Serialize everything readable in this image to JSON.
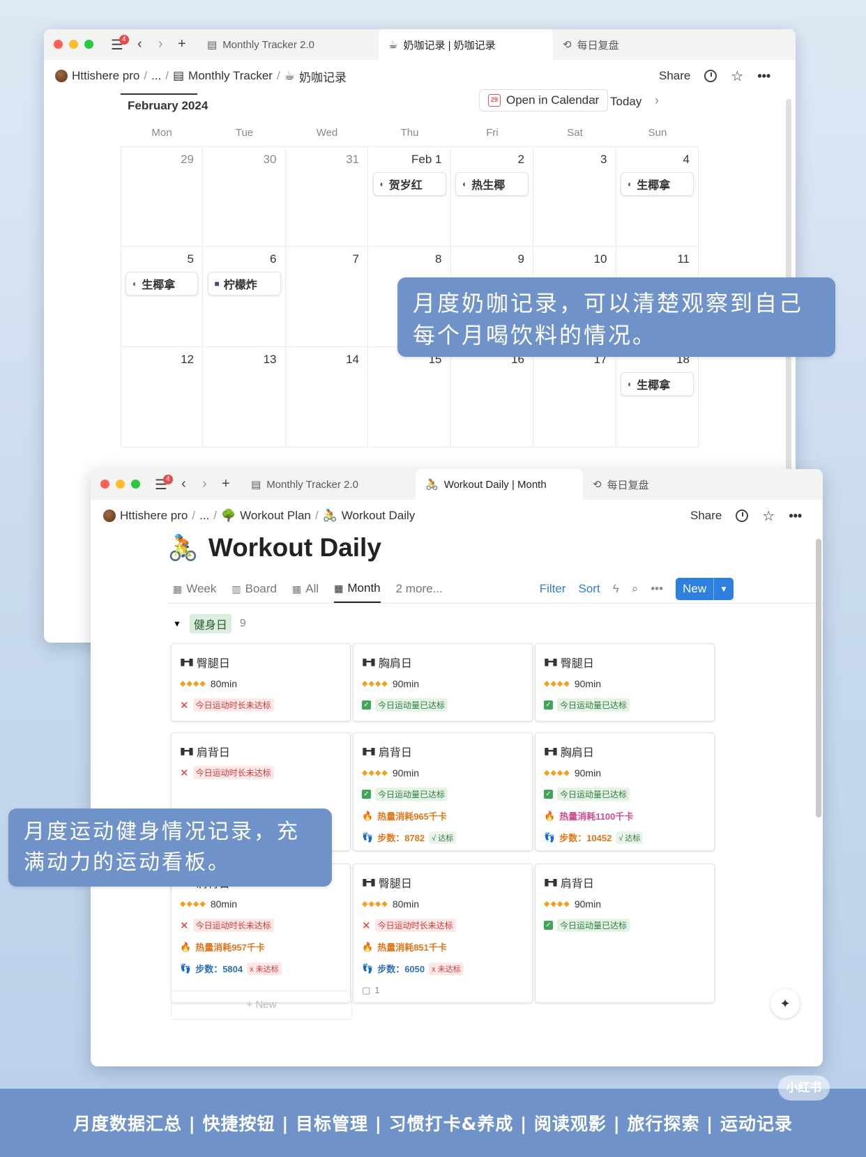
{
  "calendar_window": {
    "tab_count": "4",
    "tabs": [
      {
        "label": "Monthly Tracker 2.0",
        "icon": "calendar-icon"
      },
      {
        "label": "奶咖记录 | 奶咖记录",
        "icon": "coffee-icon"
      },
      {
        "label": "每日复盘",
        "icon": "history-icon"
      }
    ],
    "breadcrumb": [
      "Httishere pro",
      "...",
      "Monthly Tracker",
      "奶咖记录"
    ],
    "share": "Share",
    "month": "February 2024",
    "open_calendar": "Open in Calendar",
    "open_calendar_icon_num": "29",
    "today": "Today",
    "weekdays": [
      "Mon",
      "Tue",
      "Wed",
      "Thu",
      "Fri",
      "Sat",
      "Sun"
    ],
    "weeks": [
      [
        {
          "d": "29"
        },
        {
          "d": "30"
        },
        {
          "d": "31"
        },
        {
          "d": "Feb 1",
          "e": "贺岁红"
        },
        {
          "d": "2",
          "e": "热生椰"
        },
        {
          "d": "3"
        },
        {
          "d": "4",
          "e": "生椰拿"
        }
      ],
      [
        {
          "d": "5",
          "e": "生椰拿"
        },
        {
          "d": "6",
          "e": "柠檬炸"
        },
        {
          "d": "7"
        },
        {
          "d": "8"
        },
        {
          "d": "9"
        },
        {
          "d": "10"
        },
        {
          "d": "11"
        }
      ],
      [
        {
          "d": "12"
        },
        {
          "d": "13"
        },
        {
          "d": "14"
        },
        {
          "d": "15"
        },
        {
          "d": "16"
        },
        {
          "d": "17"
        },
        {
          "d": "18",
          "e": "生椰拿"
        }
      ]
    ]
  },
  "callout_top": "月度奶咖记录，可以清楚观察到自己每个月喝饮料的情况。",
  "workout_window": {
    "tab_count": "4",
    "tabs": [
      {
        "label": "Monthly Tracker 2.0",
        "icon": "calendar-icon"
      },
      {
        "label": "Workout Daily | Month",
        "icon": "cyclist-icon"
      },
      {
        "label": "每日复盘",
        "icon": "history-icon"
      }
    ],
    "breadcrumb": [
      "Httishere pro",
      "...",
      "Workout Plan",
      "Workout Daily"
    ],
    "share": "Share",
    "title": "Workout Daily",
    "views": [
      "Week",
      "Board",
      "All",
      "Month",
      "2 more..."
    ],
    "filter": "Filter",
    "sort": "Sort",
    "new": "New",
    "group_label": "健身日",
    "group_count": "9",
    "cards": [
      {
        "title": "臀腿日",
        "mins": "80min",
        "status": "今日运动时长未达标",
        "good": false
      },
      {
        "title": "胸肩日",
        "mins": "90min",
        "status": "今日运动量已达标",
        "good": true
      },
      {
        "title": "臀腿日",
        "mins": "90min",
        "status": "今日运动量已达标",
        "good": true
      },
      {
        "title": "肩背日",
        "mins": "",
        "status": "今日运动时长未达标",
        "good": false
      },
      {
        "title": "肩背日",
        "mins": "90min",
        "status": "今日运动量已达标",
        "good": true,
        "cal": "热量消耗965千卡",
        "steps": "步数：8782",
        "step_ok": "√ 达标"
      },
      {
        "title": "胸肩日",
        "mins": "90min",
        "status": "今日运动量已达标",
        "good": true,
        "cal": "热量消耗1100千卡",
        "steps": "步数：10452",
        "step_ok": "√ 达标"
      },
      {
        "title": "肩背日",
        "mins": "80min",
        "status": "今日运动时长未达标",
        "good": false,
        "cal": "热量消耗957千卡",
        "steps": "步数：5804",
        "step_bad": "x 未达标"
      },
      {
        "title": "臀腿日",
        "mins": "80min",
        "status": "今日运动时长未达标",
        "good": false,
        "cal": "热量消耗851千卡",
        "steps": "步数：6050",
        "step_bad": "x 未达标",
        "comments": "1"
      },
      {
        "title": "肩背日",
        "mins": "90min",
        "status": "今日运动量已达标",
        "good": true
      }
    ],
    "add_new": "+ New"
  },
  "callout_bottom": "月度运动健身情况记录，充满动力的运动看板。",
  "bottom_banner": "月度数据汇总 | 快捷按钮 | 目标管理 | 习惯打卡&养成 | 阅读观影 | 旅行探索 | 运动记录",
  "watermark": "小红书",
  "colors": {
    "accent": "#2d7fe0",
    "callout": "#6f93c9"
  }
}
